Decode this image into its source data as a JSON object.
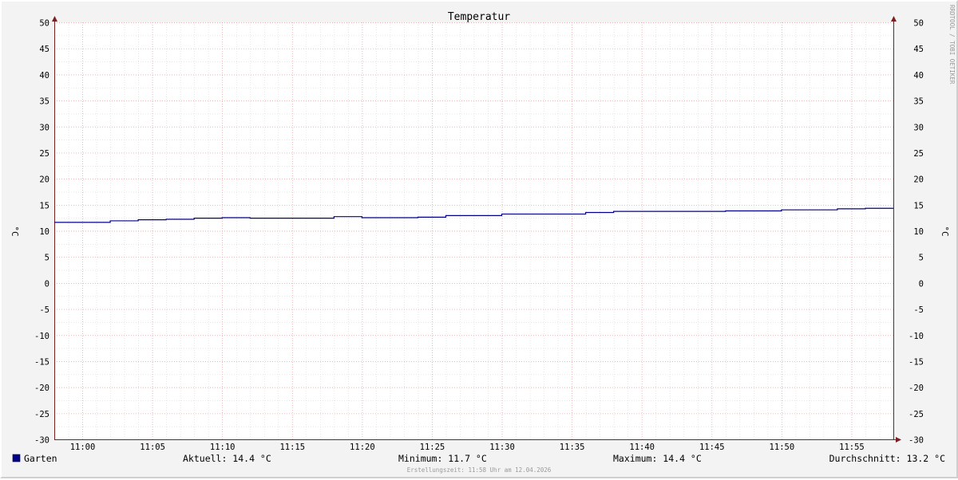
{
  "chart_data": {
    "type": "line",
    "title": "Temperatur",
    "ylabel": "°C",
    "ylim": [
      -30,
      50
    ],
    "y_ticks": [
      "50",
      "45",
      "40",
      "35",
      "30",
      "25",
      "20",
      "15",
      "10",
      "5",
      "0",
      "-5",
      "-10",
      "-15",
      "-20",
      "-25",
      "-30"
    ],
    "x_ticks": [
      "11:00",
      "11:05",
      "11:10",
      "11:15",
      "11:20",
      "11:25",
      "11:30",
      "11:35",
      "11:40",
      "11:45",
      "11:50",
      "11:55"
    ],
    "x_range": [
      "10:58",
      "11:58"
    ],
    "grid": true,
    "series": [
      {
        "name": "Garten",
        "color": "#00008b",
        "step": true,
        "x": [
          "10:58",
          "11:02",
          "11:04",
          "11:06",
          "11:08",
          "11:10",
          "11:12",
          "11:14",
          "11:16",
          "11:18",
          "11:20",
          "11:22",
          "11:24",
          "11:26",
          "11:28",
          "11:30",
          "11:32",
          "11:34",
          "11:36",
          "11:38",
          "11:40",
          "11:42",
          "11:44",
          "11:46",
          "11:48",
          "11:50",
          "11:52",
          "11:54",
          "11:56",
          "11:58"
        ],
        "values": [
          11.7,
          12.0,
          12.2,
          12.3,
          12.5,
          12.6,
          12.5,
          12.5,
          12.5,
          12.8,
          12.6,
          12.6,
          12.7,
          13.0,
          13.0,
          13.3,
          13.3,
          13.3,
          13.6,
          13.8,
          13.8,
          13.8,
          13.8,
          13.9,
          13.9,
          14.1,
          14.1,
          14.3,
          14.4,
          14.4
        ]
      }
    ]
  },
  "legend": {
    "series_label": "Garten",
    "current": "Aktuell: 14.4 °C",
    "minimum": "Minimum: 11.7 °C",
    "maximum": "Maximum: 14.4 °C",
    "average": "Durchschnitt: 13.2 °C"
  },
  "footer": "Erstellungszeit: 11:58 Uhr am 12.04.2026",
  "watermark": "RRDTOOL / TOBI OETIKER",
  "colors": {
    "background": "#f3f3f3",
    "plot_background": "#ffffff",
    "minor_grid": "#d8d8d8",
    "major_grid": "#e8a0a0",
    "axis": "#7a2020",
    "series": "#00008b"
  }
}
